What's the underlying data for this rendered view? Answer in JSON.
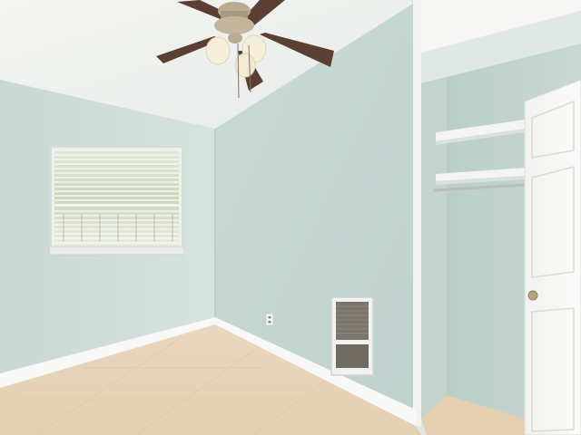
{
  "scene": {
    "type": "photo",
    "subject": "empty-bedroom-interior",
    "colors": {
      "ceiling": "#f1f3f1",
      "wall_left": "#cfdcd7",
      "wall_center": "#c6d7d2",
      "closet_interior": "#bdd0cb",
      "trim": "#f7f7f5",
      "floor": "#e9d6bb",
      "fan_blade": "#5b3f32",
      "fan_metal": "#b9aa91",
      "door": "#f5f5f3",
      "vent": "#7a756d"
    },
    "elements": [
      "ceiling-fan-icon",
      "window-blinds-icon",
      "wall-heater-vent-icon",
      "closet-shelves-icon",
      "closet-door-icon",
      "electrical-outlet-icon",
      "tile-floor-icon"
    ]
  }
}
